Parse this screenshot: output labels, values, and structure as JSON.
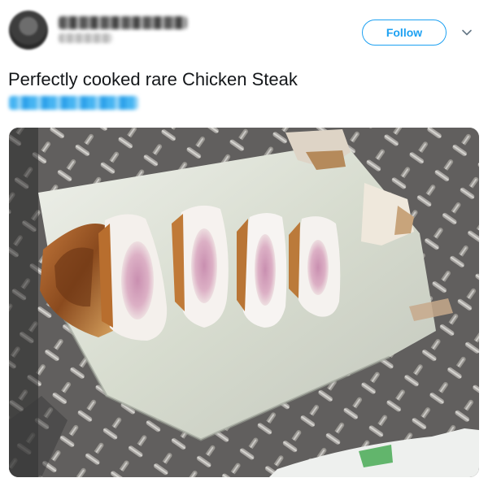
{
  "tweet": {
    "follow_label": "Follow",
    "text": "Perfectly cooked rare Chicken Steak"
  },
  "colors": {
    "accent": "#1da1f2",
    "text": "#14171a"
  },
  "icons": {
    "caret": "chevron-down-icon"
  }
}
